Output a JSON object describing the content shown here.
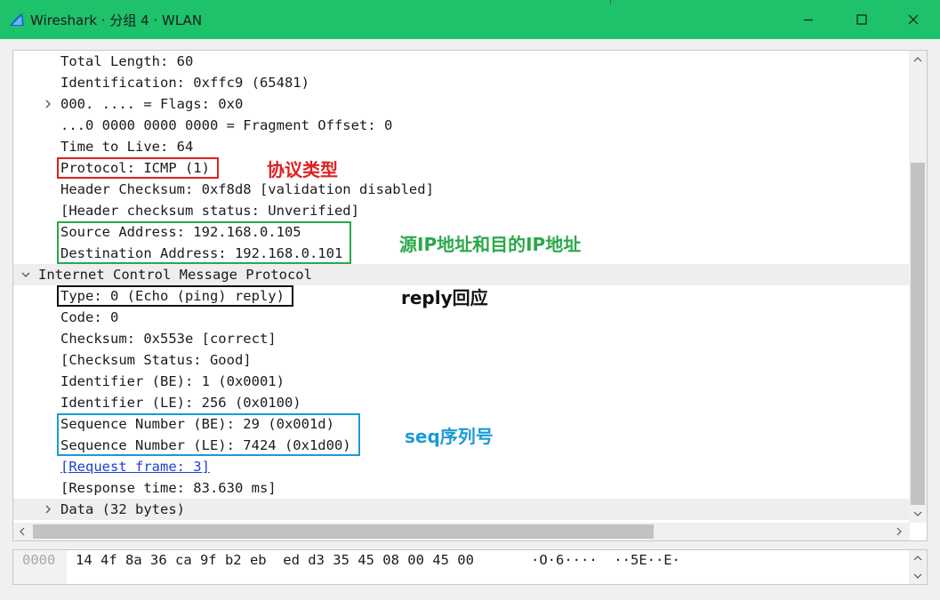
{
  "window": {
    "title": "Wireshark · 分组 4 · WLAN",
    "app_icon": "shark-fin-icon",
    "title_bar_color": "#1dc26a",
    "controls": [
      "minimize-icon",
      "maximize-icon",
      "close-icon"
    ]
  },
  "tree": {
    "rows": [
      {
        "text": "Total Length: 60",
        "level": 1,
        "expander": "none"
      },
      {
        "text": "Identification: 0xffc9 (65481)",
        "level": 1,
        "expander": "none"
      },
      {
        "text": "000. .... = Flags: 0x0",
        "level": 1,
        "expander": "collapsed"
      },
      {
        "text": "...0 0000 0000 0000 = Fragment Offset: 0",
        "level": 1,
        "expander": "none"
      },
      {
        "text": "Time to Live: 64",
        "level": 1,
        "expander": "none"
      },
      {
        "text": "Protocol: ICMP (1)",
        "level": 1,
        "expander": "none"
      },
      {
        "text": "Header Checksum: 0xf8d8 [validation disabled]",
        "level": 1,
        "expander": "none"
      },
      {
        "text": "[Header checksum status: Unverified]",
        "level": 1,
        "expander": "none"
      },
      {
        "text": "Source Address: 192.168.0.105",
        "level": 1,
        "expander": "none"
      },
      {
        "text": "Destination Address: 192.168.0.101",
        "level": 1,
        "expander": "none"
      },
      {
        "text": "Internet Control Message Protocol",
        "level": 0,
        "expander": "expanded",
        "highlighted": true
      },
      {
        "text": "Type: 0 (Echo (ping) reply)",
        "level": 1,
        "expander": "none"
      },
      {
        "text": "Code: 0",
        "level": 1,
        "expander": "none"
      },
      {
        "text": "Checksum: 0x553e [correct]",
        "level": 1,
        "expander": "none"
      },
      {
        "text": "[Checksum Status: Good]",
        "level": 1,
        "expander": "none"
      },
      {
        "text": "Identifier (BE): 1 (0x0001)",
        "level": 1,
        "expander": "none"
      },
      {
        "text": "Identifier (LE): 256 (0x0100)",
        "level": 1,
        "expander": "none"
      },
      {
        "text": "Sequence Number (BE): 29 (0x001d)",
        "level": 1,
        "expander": "none"
      },
      {
        "text": "Sequence Number (LE): 7424 (0x1d00)",
        "level": 1,
        "expander": "none"
      },
      {
        "text": "[Request frame: 3]",
        "level": 1,
        "expander": "none",
        "link": true
      },
      {
        "text": "[Response time: 83.630 ms]",
        "level": 1,
        "expander": "none"
      },
      {
        "text": "Data (32 bytes)",
        "level": 1,
        "expander": "collapsed",
        "highlighted": true
      }
    ]
  },
  "annotations": [
    {
      "label": "协议类型",
      "color": "#e02020",
      "rows": [
        5
      ]
    },
    {
      "label": "源IP地址和目的IP地址",
      "color": "#2aa84a",
      "rows": [
        8,
        9
      ]
    },
    {
      "label": "reply回应",
      "color": "#111111",
      "rows": [
        11
      ]
    },
    {
      "label": "seq序列号",
      "color": "#1a9ad6",
      "rows": [
        17,
        18
      ]
    }
  ],
  "hex": {
    "offset": "0000",
    "bytes": "14 4f 8a 36 ca 9f b2 eb  ed d3 35 45 08 00 45 00",
    "ascii": "·O·6····  ··5E··E·"
  }
}
